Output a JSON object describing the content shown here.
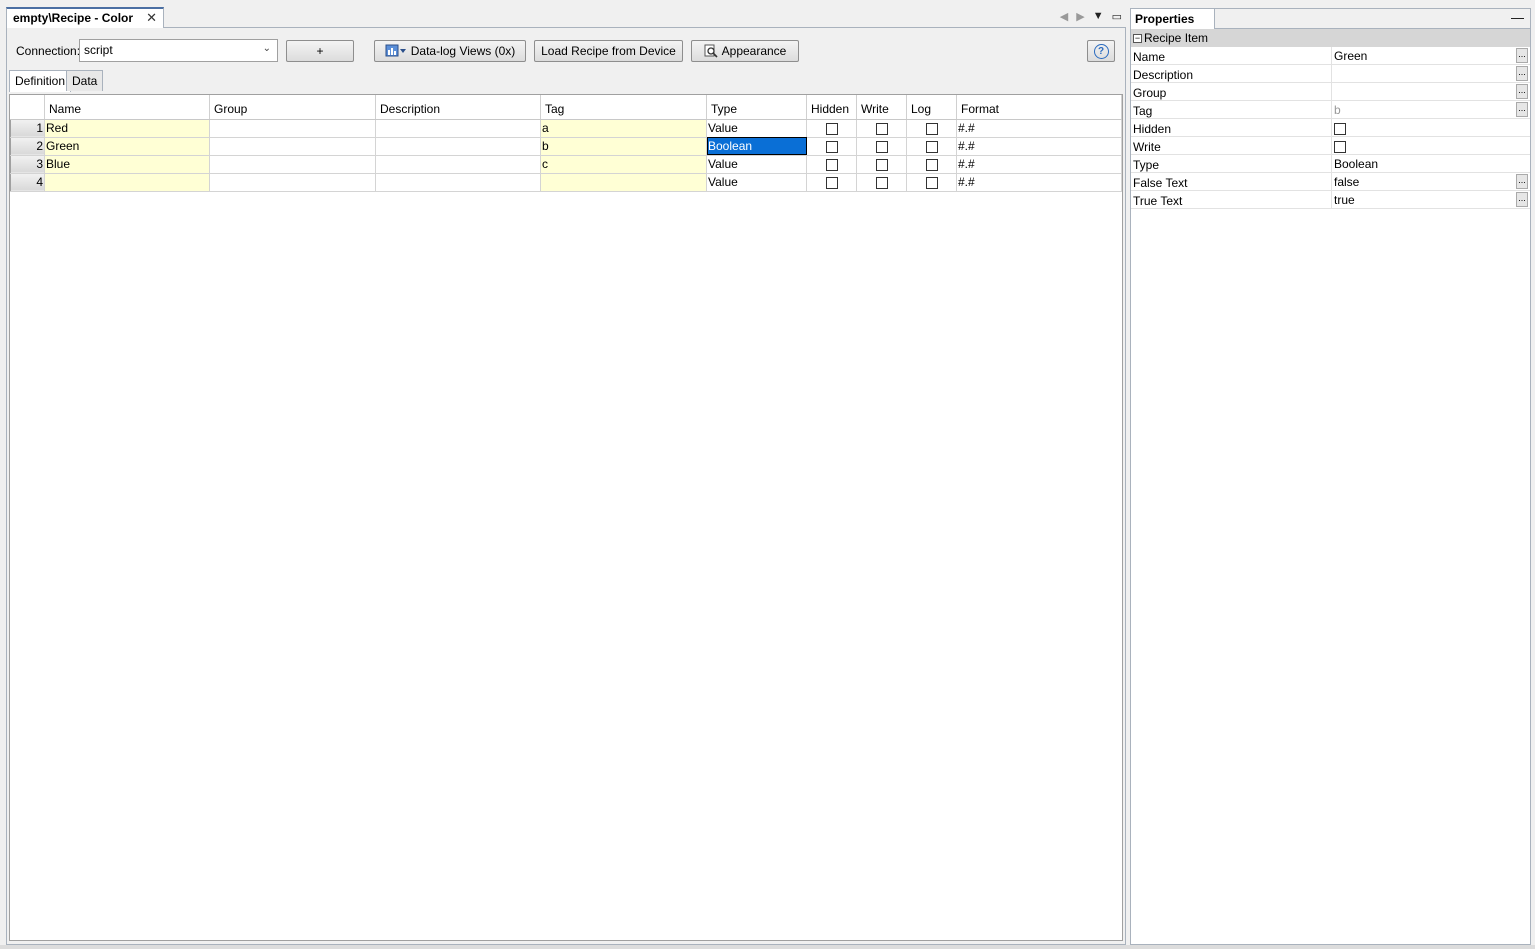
{
  "editor": {
    "tab_title": "empty\\Recipe - Color",
    "tab_close": "✕"
  },
  "toolbar": {
    "connection_label": "Connection:",
    "connection_value": "script",
    "plus_label": "+",
    "datalog_label": "Data-log Views (0x)",
    "load_label": "Load Recipe from Device",
    "appearance_label": "Appearance",
    "help_label": "?"
  },
  "subtabs": [
    "Definition",
    "Data"
  ],
  "grid": {
    "columns": [
      "Name",
      "Group",
      "Description",
      "Tag",
      "Type",
      "Hidden",
      "Write",
      "Log",
      "Format"
    ],
    "rows": [
      {
        "num": "1",
        "name": "Red",
        "group": "",
        "description": "",
        "tag": "a",
        "type": "Value",
        "format": "#.#"
      },
      {
        "num": "2",
        "name": "Green",
        "group": "",
        "description": "",
        "tag": "b",
        "type": "Boolean",
        "format": "#.#"
      },
      {
        "num": "3",
        "name": "Blue",
        "group": "",
        "description": "",
        "tag": "c",
        "type": "Value",
        "format": "#.#"
      },
      {
        "num": "4",
        "name": "",
        "group": "",
        "description": "",
        "tag": "",
        "type": "Value",
        "format": "#.#"
      }
    ]
  },
  "properties": {
    "title": "Properties",
    "category": "Recipe Item",
    "rows": [
      {
        "name": "Name",
        "value": "Green"
      },
      {
        "name": "Description",
        "value": ""
      },
      {
        "name": "Group",
        "value": ""
      },
      {
        "name": "Tag",
        "value": "b"
      },
      {
        "name": "Hidden",
        "value": ""
      },
      {
        "name": "Write",
        "value": ""
      },
      {
        "name": "Type",
        "value": "Boolean"
      },
      {
        "name": "False Text",
        "value": "false"
      },
      {
        "name": "True Text",
        "value": "true"
      }
    ],
    "ellipsis": "..."
  },
  "icons": {
    "datalog": "grid-chart-icon",
    "appearance": "magnifier-icon",
    "help": "help-icon"
  },
  "colors": {
    "selection": "#0a6fd6",
    "required_cell": "#ffffd5"
  }
}
